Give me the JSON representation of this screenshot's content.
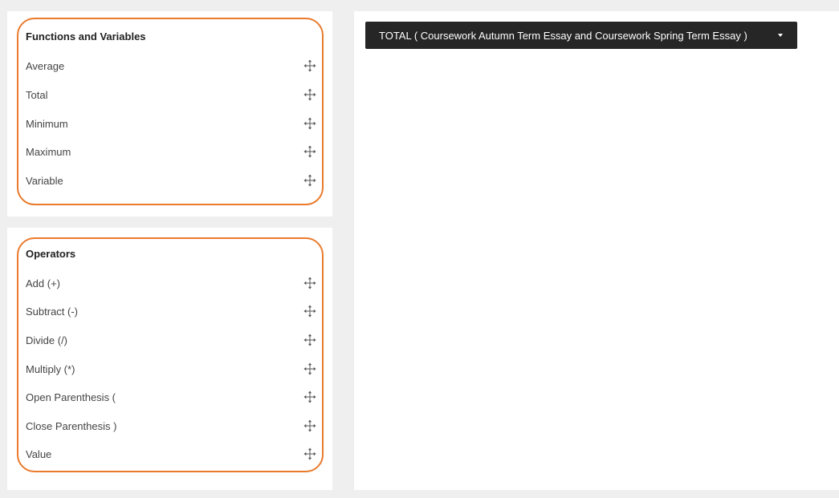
{
  "functions_panel": {
    "title": "Functions and Variables",
    "items": [
      "Average",
      "Total",
      "Minimum",
      "Maximum",
      "Variable"
    ]
  },
  "operators_panel": {
    "title": "Operators",
    "items": [
      "Add (+)",
      "Subtract (-)",
      "Divide (/)",
      "Multiply (*)",
      "Open Parenthesis (",
      "Close Parenthesis )",
      "Value"
    ]
  },
  "formula": {
    "dropdown_label": "TOTAL ( Coursework Autumn Term Essay and Coursework Spring Term Essay )"
  },
  "icons": {
    "drag_handle": "move-arrows-icon",
    "dropdown": "caret-down-icon"
  },
  "colors": {
    "highlight": "#ea7a2c",
    "dropdown_bg": "#262626",
    "page_bg": "#efefef"
  }
}
